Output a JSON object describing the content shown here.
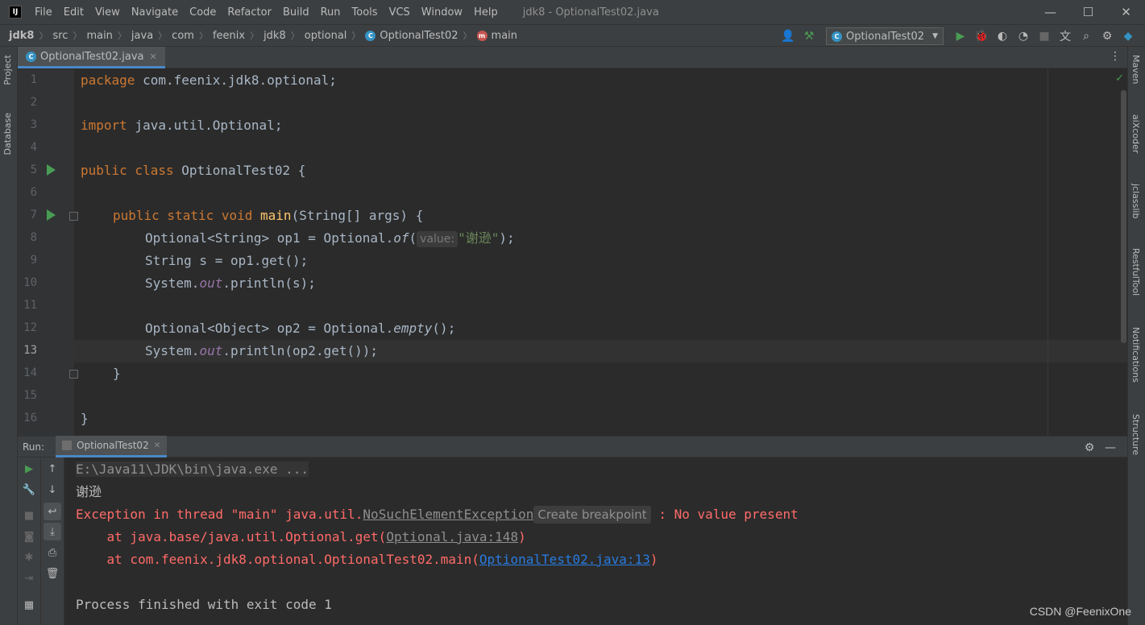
{
  "titlebar": {
    "logo": "IJ",
    "menu": [
      "File",
      "Edit",
      "View",
      "Navigate",
      "Code",
      "Refactor",
      "Build",
      "Run",
      "Tools",
      "VCS",
      "Window",
      "Help"
    ],
    "window_title": "jdk8 - OptionalTest02.java",
    "controls": {
      "minimize": "—",
      "maximize": "☐",
      "close": "✕"
    }
  },
  "navbar": {
    "breadcrumbs": [
      "jdk8",
      "src",
      "main",
      "java",
      "com",
      "feenix",
      "jdk8",
      "optional",
      "OptionalTest02",
      "main"
    ],
    "run_config": "OptionalTest02"
  },
  "left_stripe": {
    "tabs": [
      "Project",
      "Database"
    ]
  },
  "right_stripe": {
    "tabs": [
      "Maven",
      "aiXcoder",
      "jclasslib",
      "RestfulTool",
      "Notifications",
      "Structure"
    ]
  },
  "editor": {
    "tab": {
      "label": "OptionalTest02.java",
      "icon": "java-class-icon"
    },
    "line_numbers": [
      "1",
      "2",
      "3",
      "4",
      "5",
      "6",
      "7",
      "8",
      "9",
      "10",
      "11",
      "12",
      "13",
      "14",
      "15",
      "16"
    ],
    "current_line": 13,
    "lines": {
      "l1": {
        "kw": "package",
        "rest": " com.feenix.jdk8.optional;"
      },
      "l3": {
        "kw": "import",
        "rest": " java.util.Optional;"
      },
      "l5": {
        "kw": "public class",
        "rest": " OptionalTest02 {"
      },
      "l7": {
        "kw": "public static void",
        "fn": "main",
        "rest": "(String[] args) {"
      },
      "l8": {
        "pre": "Optional<String> op1 = Optional.",
        "method": "of",
        "paren": "(",
        "hint": "value:",
        "str": "\"谢逊\"",
        "post": ");"
      },
      "l9": {
        "text": "String s = op1.get();"
      },
      "l10": {
        "pre": "System.",
        "field": "out",
        "post": ".println(s);"
      },
      "l12": {
        "pre": "Optional<Object> op2 = Optional.",
        "method": "empty",
        "post": "();"
      },
      "l13": {
        "pre": "System.",
        "field": "out",
        "post": ".println(op2.get());"
      },
      "l14": {
        "text": "}"
      },
      "l16": {
        "text": "}"
      }
    }
  },
  "run_panel": {
    "label": "Run:",
    "tab": "OptionalTest02",
    "console": {
      "cmd": "E:\\Java11\\JDK\\bin\\java.exe ...",
      "output": "谢逊",
      "exc_prefix": "Exception in thread \"main\" java.util.",
      "exc_class": "NoSuchElementException",
      "exc_hint": "Create breakpoint",
      "exc_suffix": " : No value present",
      "trace1_prefix": "    at java.base/java.util.Optional.get(",
      "trace1_link": "Optional.java:148",
      "trace1_suffix": ")",
      "trace2_prefix": "    at com.feenix.jdk8.optional.OptionalTest02.main(",
      "trace2_link": "OptionalTest02.java:13",
      "trace2_suffix": ")",
      "finish": "Process finished with exit code 1"
    }
  },
  "watermark": "CSDN @FeenixOne"
}
